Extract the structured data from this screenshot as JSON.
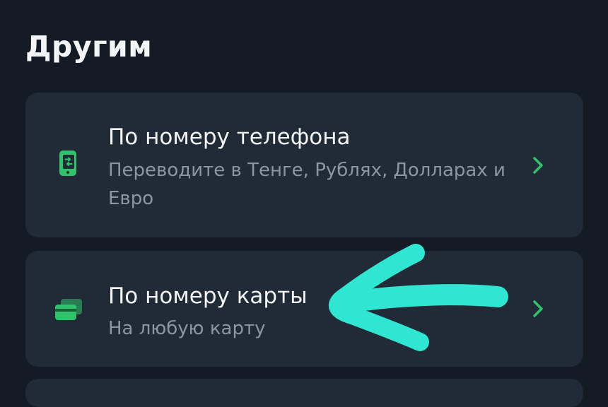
{
  "section": {
    "title": "Другим"
  },
  "options": [
    {
      "title": "По номеру телефона",
      "subtitle": "Переводите в Тенге, Рублях, Долларах и Евро",
      "icon": "phone-transfer-icon"
    },
    {
      "title": "По номеру карты",
      "subtitle": "На любую карту",
      "icon": "cards-icon"
    }
  ],
  "colors": {
    "background": "#141b25",
    "card": "#212b37",
    "accent": "#2fc36a",
    "annotation": "#2ee6d2"
  }
}
